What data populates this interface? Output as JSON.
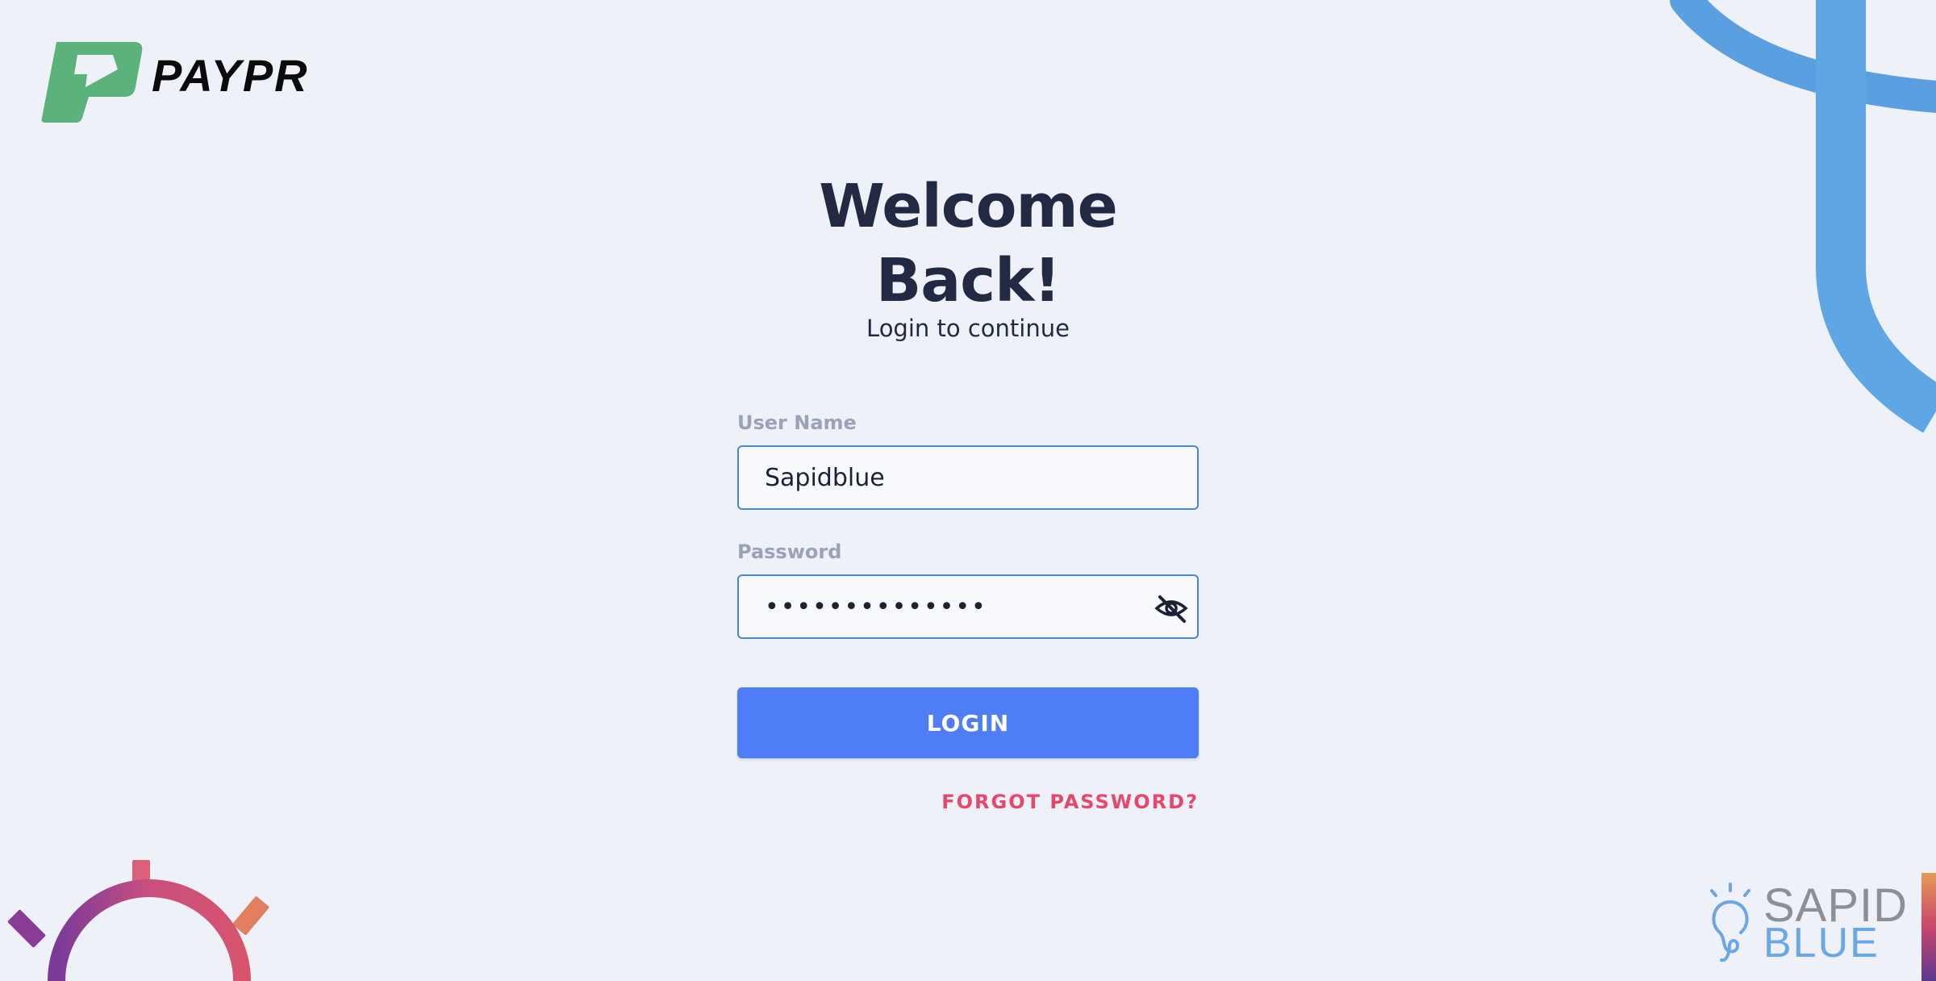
{
  "brand": {
    "logo_text": "PAYPR",
    "logo_color": "#5bb27a"
  },
  "login": {
    "title": "Welcome Back!",
    "subtitle": "Login to continue",
    "username_label": "User Name",
    "username_value": "Sapidblue",
    "password_label": "Password",
    "password_value": "••••••••••••••",
    "toggle_icon": "eye-off-icon",
    "login_button": "LOGIN",
    "forgot_link": "FORGOT PASSWORD?"
  },
  "footer_brand": {
    "line1": "SAPID",
    "line2": "BLUE"
  },
  "colors": {
    "background": "#eef1f8",
    "accent": "#4f7df5",
    "link": "#e8476b",
    "input_border": "#4e86d6",
    "title": "#222a43"
  }
}
